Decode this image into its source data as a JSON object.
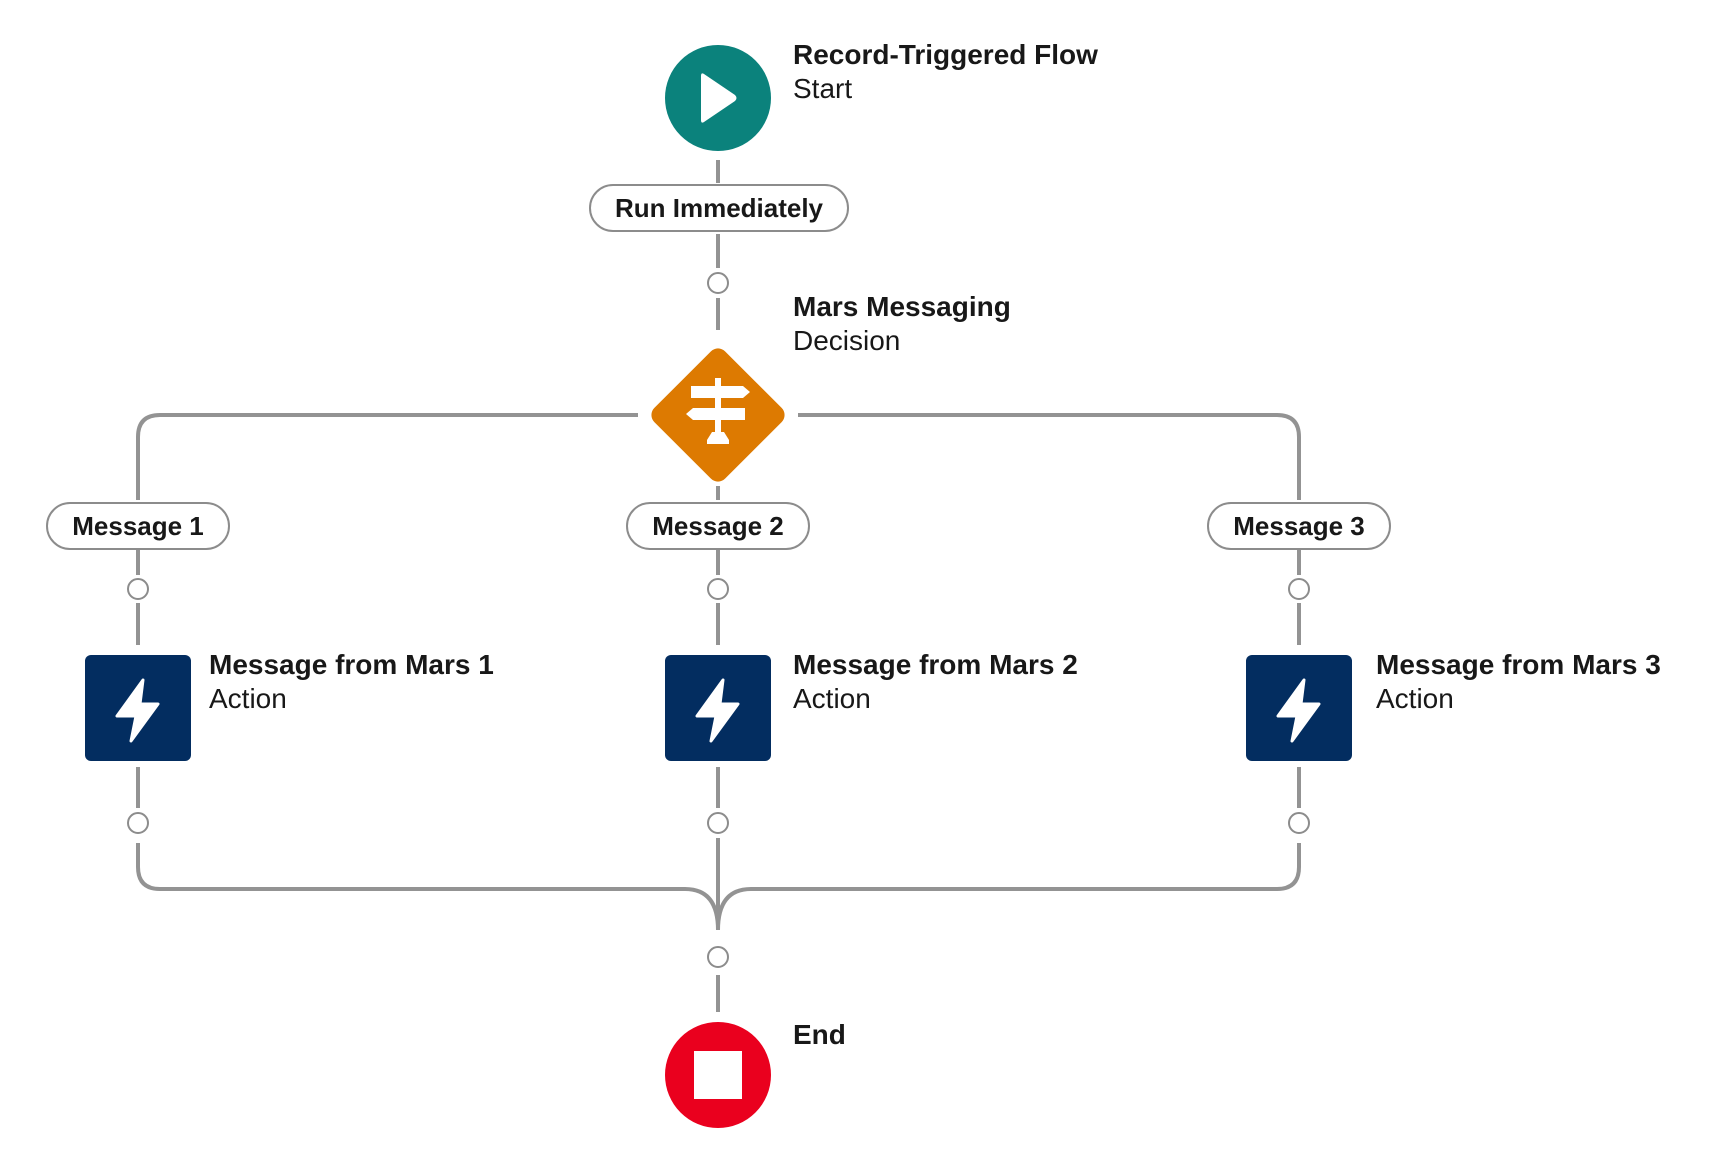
{
  "colors": {
    "connector": "#939393",
    "start": "#0b827c",
    "decision": "#dd7a01",
    "action": "#032d60",
    "end": "#ea001e",
    "pill_border": "#8c8c8c"
  },
  "start": {
    "title": "Record-Triggered Flow",
    "type": "Start",
    "icon": "play-icon"
  },
  "path_label": "Run Immediately",
  "decision": {
    "title": "Mars Messaging",
    "type": "Decision",
    "icon": "signpost-icon"
  },
  "outcomes": [
    {
      "label": "Message 1",
      "action": {
        "title": "Message from Mars 1",
        "type": "Action",
        "icon": "lightning-icon"
      }
    },
    {
      "label": "Message 2",
      "action": {
        "title": "Message from Mars 2",
        "type": "Action",
        "icon": "lightning-icon"
      }
    },
    {
      "label": "Message 3",
      "action": {
        "title": "Message from Mars 3",
        "type": "Action",
        "icon": "lightning-icon"
      }
    }
  ],
  "end": {
    "title": "End",
    "icon": "stop-icon"
  }
}
